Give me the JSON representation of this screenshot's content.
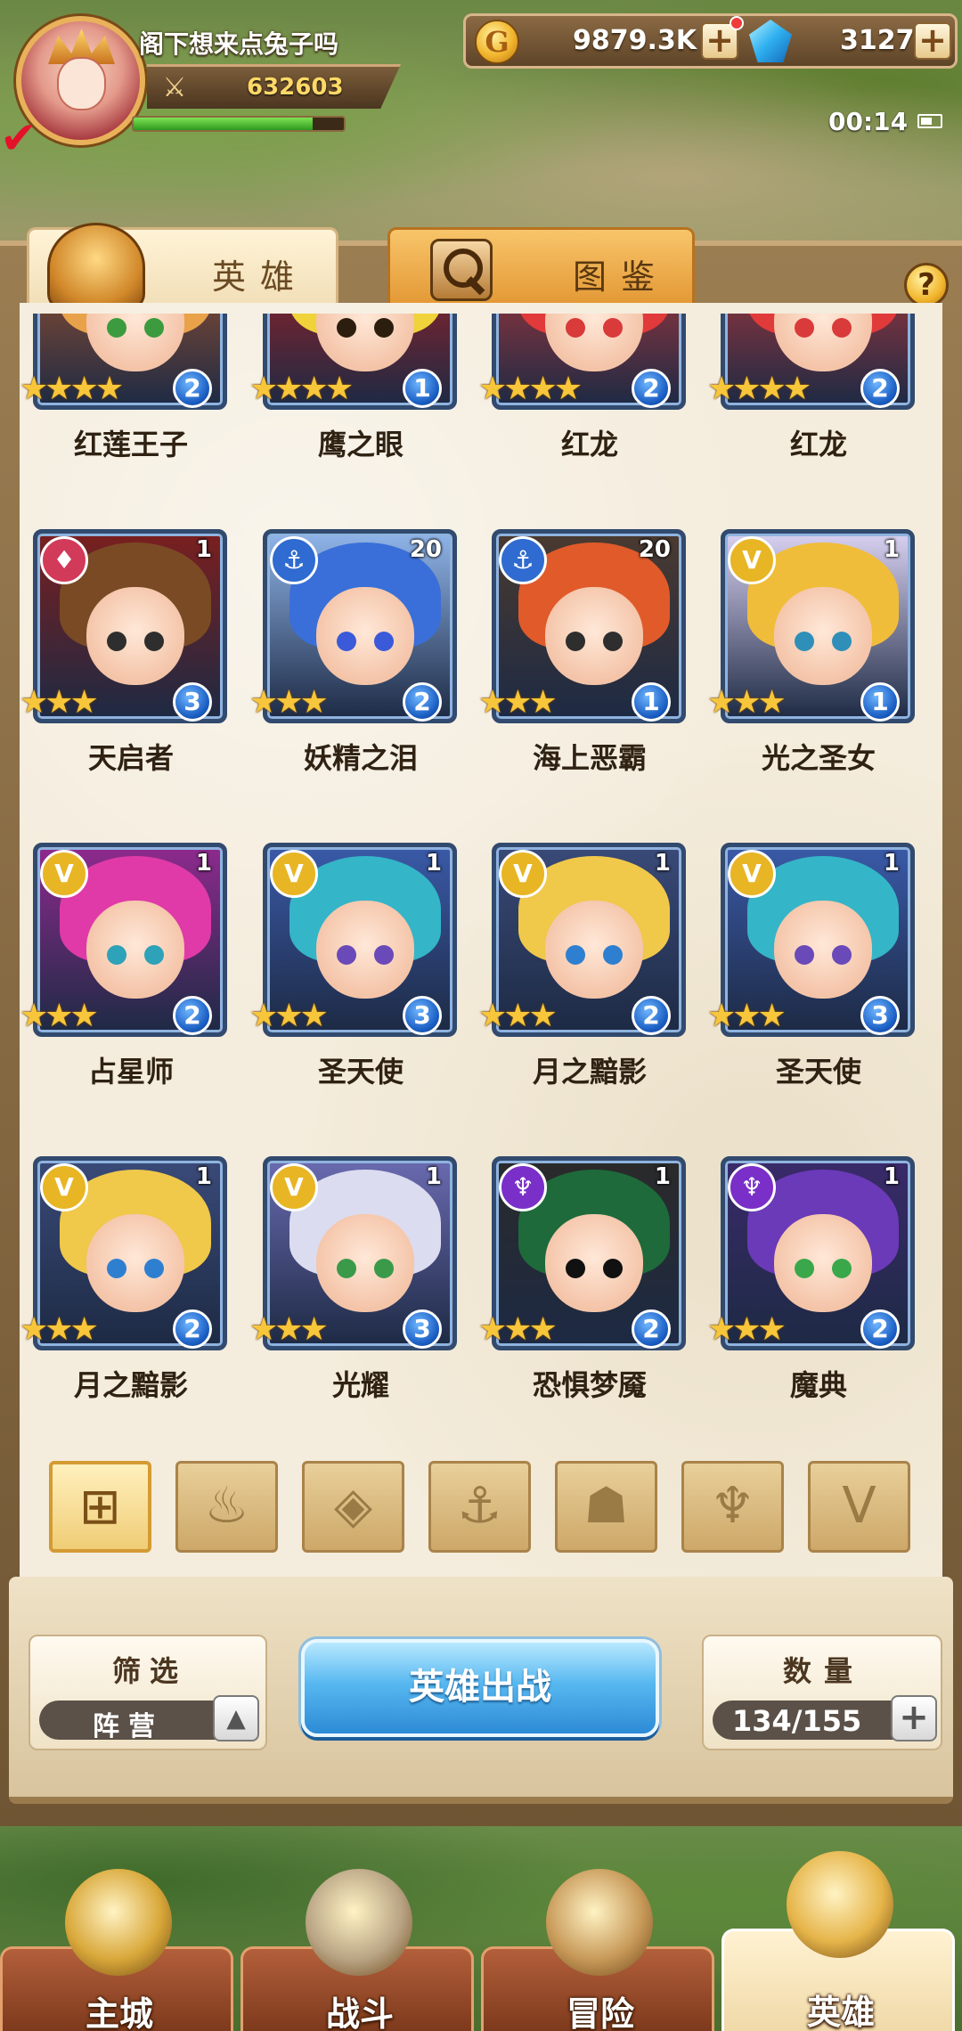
{
  "player": {
    "name": "阁下想来点兔子吗",
    "power": "632603",
    "exp_fraction": 0.85
  },
  "currency": {
    "gold_symbol": "G",
    "gold": "9879.3K",
    "gems": "3127",
    "plus": "+"
  },
  "status": {
    "time": "00:14"
  },
  "tabs": [
    {
      "label": "英雄"
    },
    {
      "label": "图鉴"
    }
  ],
  "help_label": "?",
  "heroes": [
    {
      "name": "红莲王子",
      "stars": "★★★★",
      "grade": "2",
      "level": "",
      "faction": "",
      "colors": {
        "hair": "#e9a24a",
        "bg": "#b35a2a",
        "eye": "#3c9b3f",
        "badge": ""
      }
    },
    {
      "name": "鹰之眼",
      "stars": "★★★★",
      "grade": "1",
      "level": "",
      "faction": "",
      "colors": {
        "hair": "#f0d23a",
        "bg": "#b91e1e",
        "eye": "#2b1e0e",
        "badge": ""
      }
    },
    {
      "name": "红龙",
      "stars": "★★★★",
      "grade": "2",
      "level": "",
      "faction": "",
      "colors": {
        "hair": "#e13a3a",
        "bg": "#c93a3a",
        "eye": "#d93a3a",
        "badge": ""
      }
    },
    {
      "name": "红龙",
      "stars": "★★★★",
      "grade": "2",
      "level": "",
      "faction": "",
      "colors": {
        "hair": "#e13a3a",
        "bg": "#c93a3a",
        "eye": "#d93a3a",
        "badge": ""
      }
    },
    {
      "name": "天启者",
      "stars": "★★★",
      "grade": "3",
      "level": "1",
      "faction": "flame-icon",
      "colors": {
        "hair": "#7a4a24",
        "bg": "#7a1f1f",
        "eye": "#2e2e2e",
        "badge": "#d23a5a"
      }
    },
    {
      "name": "妖精之泪",
      "stars": "★★★",
      "grade": "2",
      "level": "20",
      "faction": "anchor-icon",
      "colors": {
        "hair": "#3a6fd9",
        "bg": "#8fb4e8",
        "eye": "#3a5ad9",
        "badge": "#2f6bd0"
      }
    },
    {
      "name": "海上恶霸",
      "stars": "★★★",
      "grade": "1",
      "level": "20",
      "faction": "anchor-icon",
      "colors": {
        "hair": "#e05a2a",
        "bg": "#4a3a30",
        "eye": "#2e2e2e",
        "badge": "#2f6bd0"
      }
    },
    {
      "name": "光之圣女",
      "stars": "★★★",
      "grade": "1",
      "level": "1",
      "faction": "wing-icon",
      "colors": {
        "hair": "#f0bd3a",
        "bg": "#d8d0f0",
        "eye": "#2f8fb8",
        "badge": "#e8b524"
      }
    },
    {
      "name": "占星师",
      "stars": "★★★",
      "grade": "2",
      "level": "1",
      "faction": "wing-icon",
      "colors": {
        "hair": "#e03aa8",
        "bg": "#8e2a8e",
        "eye": "#2ea2b8",
        "badge": "#e8b524"
      }
    },
    {
      "name": "圣天使",
      "stars": "★★★",
      "grade": "3",
      "level": "1",
      "faction": "wing-icon",
      "colors": {
        "hair": "#34b5c8",
        "bg": "#3a5aa8",
        "eye": "#6a4ab8",
        "badge": "#e8b524"
      }
    },
    {
      "name": "月之黯影",
      "stars": "★★★",
      "grade": "2",
      "level": "1",
      "faction": "wing-icon",
      "colors": {
        "hair": "#f0c84a",
        "bg": "#3a4a78",
        "eye": "#2f7fd0",
        "badge": "#e8b524"
      }
    },
    {
      "name": "圣天使",
      "stars": "★★★",
      "grade": "3",
      "level": "1",
      "faction": "wing-icon",
      "colors": {
        "hair": "#34b5c8",
        "bg": "#3a5aa8",
        "eye": "#6a4ab8",
        "badge": "#e8b524"
      }
    },
    {
      "name": "月之黯影",
      "stars": "★★★",
      "grade": "2",
      "level": "1",
      "faction": "wing-icon",
      "colors": {
        "hair": "#f0c84a",
        "bg": "#3a4a78",
        "eye": "#2f7fd0",
        "badge": "#e8b524"
      }
    },
    {
      "name": "光耀",
      "stars": "★★★",
      "grade": "3",
      "level": "1",
      "faction": "wing-icon",
      "colors": {
        "hair": "#dcdcf0",
        "bg": "#6a6ab0",
        "eye": "#3a9a4a",
        "badge": "#e8b524"
      }
    },
    {
      "name": "恐惧梦魇",
      "stars": "★★★",
      "grade": "2",
      "level": "1",
      "faction": "demon-icon",
      "colors": {
        "hair": "#1e6a3a",
        "bg": "#2a2a2a",
        "eye": "#111111",
        "badge": "#7a2fc8"
      }
    },
    {
      "name": "魔典",
      "stars": "★★★",
      "grade": "2",
      "level": "1",
      "faction": "demon-icon",
      "colors": {
        "hair": "#6a3ab8",
        "bg": "#3a2a6a",
        "eye": "#3aa84a",
        "badge": "#7a2fc8"
      }
    }
  ],
  "filters": [
    {
      "icon": "grid-icon",
      "glyph": "⊞",
      "active": true
    },
    {
      "icon": "flame-icon",
      "glyph": "♨",
      "active": false
    },
    {
      "icon": "diamond-icon",
      "glyph": "◈",
      "active": false
    },
    {
      "icon": "anchor-icon",
      "glyph": "⚓",
      "active": false
    },
    {
      "icon": "beast-icon",
      "glyph": "☗",
      "active": false
    },
    {
      "icon": "demon-icon",
      "glyph": "♆",
      "active": false
    },
    {
      "icon": "wing-icon",
      "glyph": "V",
      "active": false
    }
  ],
  "filter_box": {
    "label": "筛选",
    "value": "阵营"
  },
  "deploy_label": "英雄出战",
  "count_box": {
    "label": "数量",
    "value": "134/155"
  },
  "nav": [
    {
      "label": "主城",
      "active": false
    },
    {
      "label": "战斗",
      "active": false
    },
    {
      "label": "冒险",
      "active": false
    },
    {
      "label": "英雄",
      "active": true
    }
  ]
}
